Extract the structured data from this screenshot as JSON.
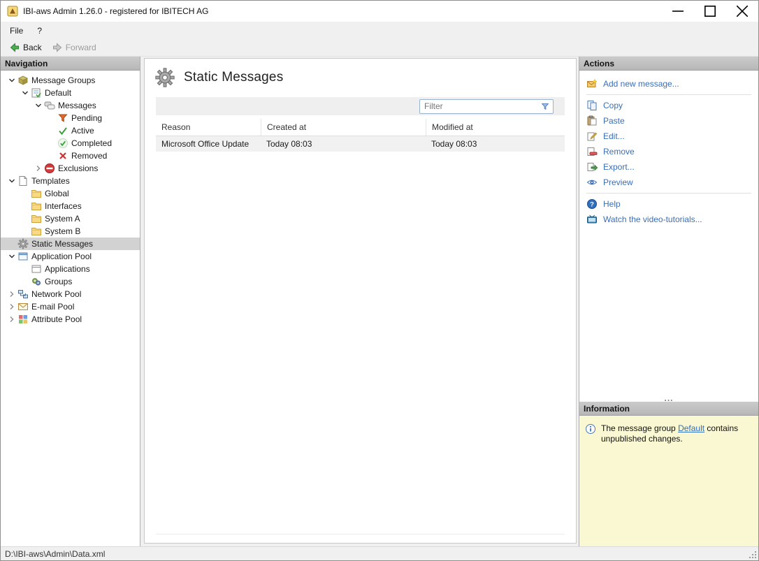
{
  "window": {
    "title": "IBI-aws Admin 1.26.0 - registered for IBITECH AG",
    "controls": [
      "minimize",
      "maximize",
      "close"
    ]
  },
  "menu": {
    "items": [
      "File",
      "?"
    ]
  },
  "toolbar": {
    "back": "Back",
    "forward": "Forward"
  },
  "navigation": {
    "header": "Navigation",
    "tree": [
      {
        "label": "Message Groups",
        "level": 0,
        "expander": "expanded",
        "icon": "message-groups-icon"
      },
      {
        "label": "Default",
        "level": 1,
        "expander": "expanded",
        "icon": "default-group-icon"
      },
      {
        "label": "Messages",
        "level": 2,
        "expander": "expanded",
        "icon": "messages-icon"
      },
      {
        "label": "Pending",
        "level": 3,
        "expander": "none",
        "icon": "pending-icon"
      },
      {
        "label": "Active",
        "level": 3,
        "expander": "none",
        "icon": "active-icon"
      },
      {
        "label": "Completed",
        "level": 3,
        "expander": "none",
        "icon": "completed-icon"
      },
      {
        "label": "Removed",
        "level": 3,
        "expander": "none",
        "icon": "removed-icon"
      },
      {
        "label": "Exclusions",
        "level": 2,
        "expander": "collapsed",
        "icon": "exclusions-icon"
      },
      {
        "label": "Templates",
        "level": 0,
        "expander": "expanded",
        "icon": "templates-icon"
      },
      {
        "label": "Global",
        "level": 1,
        "expander": "none",
        "icon": "folder-icon"
      },
      {
        "label": "Interfaces",
        "level": 1,
        "expander": "none",
        "icon": "folder-icon"
      },
      {
        "label": "System A",
        "level": 1,
        "expander": "none",
        "icon": "folder-icon"
      },
      {
        "label": "System B",
        "level": 1,
        "expander": "none",
        "icon": "folder-icon"
      },
      {
        "label": "Static Messages",
        "level": 0,
        "expander": "none",
        "icon": "static-messages-icon",
        "selected": true
      },
      {
        "label": "Application Pool",
        "level": 0,
        "expander": "expanded",
        "icon": "application-pool-icon"
      },
      {
        "label": "Applications",
        "level": 1,
        "expander": "none",
        "icon": "applications-icon"
      },
      {
        "label": "Groups",
        "level": 1,
        "expander": "none",
        "icon": "groups-icon"
      },
      {
        "label": "Network Pool",
        "level": 0,
        "expander": "collapsed",
        "icon": "network-pool-icon"
      },
      {
        "label": "E-mail Pool",
        "level": 0,
        "expander": "collapsed",
        "icon": "email-pool-icon"
      },
      {
        "label": "Attribute Pool",
        "level": 0,
        "expander": "collapsed",
        "icon": "attribute-pool-icon"
      }
    ]
  },
  "main": {
    "title": "Static Messages",
    "filter_placeholder": "Filter",
    "table": {
      "columns": [
        "Reason",
        "Created at",
        "Modified at"
      ],
      "rows": [
        [
          "Microsoft Office Update",
          "Today 08:03",
          "Today 08:03"
        ]
      ]
    }
  },
  "actions": {
    "header": "Actions",
    "overflow": "...",
    "groups": [
      {
        "items": [
          {
            "label": "Add new message...",
            "icon": "add-message-icon"
          }
        ]
      },
      {
        "items": [
          {
            "label": "Copy",
            "icon": "copy-icon"
          },
          {
            "label": "Paste",
            "icon": "paste-icon"
          },
          {
            "label": "Edit...",
            "icon": "edit-icon"
          },
          {
            "label": "Remove",
            "icon": "remove-icon"
          },
          {
            "label": "Export...",
            "icon": "export-icon"
          },
          {
            "label": "Preview",
            "icon": "preview-icon"
          }
        ]
      },
      {
        "items": [
          {
            "label": "Help",
            "icon": "help-icon"
          },
          {
            "label": "Watch the video-tutorials...",
            "icon": "video-tutorials-icon"
          }
        ]
      }
    ]
  },
  "information": {
    "header": "Information",
    "text_before": "The message group ",
    "link_label": "Default",
    "text_after": " contains unpublished changes."
  },
  "statusbar": {
    "path": "D:\\IBI-aws\\Admin\\Data.xml"
  },
  "colors": {
    "link_blue": "#3a6eb5",
    "info_background": "#faf8d2",
    "selection_gray": "#d2d2d2"
  }
}
